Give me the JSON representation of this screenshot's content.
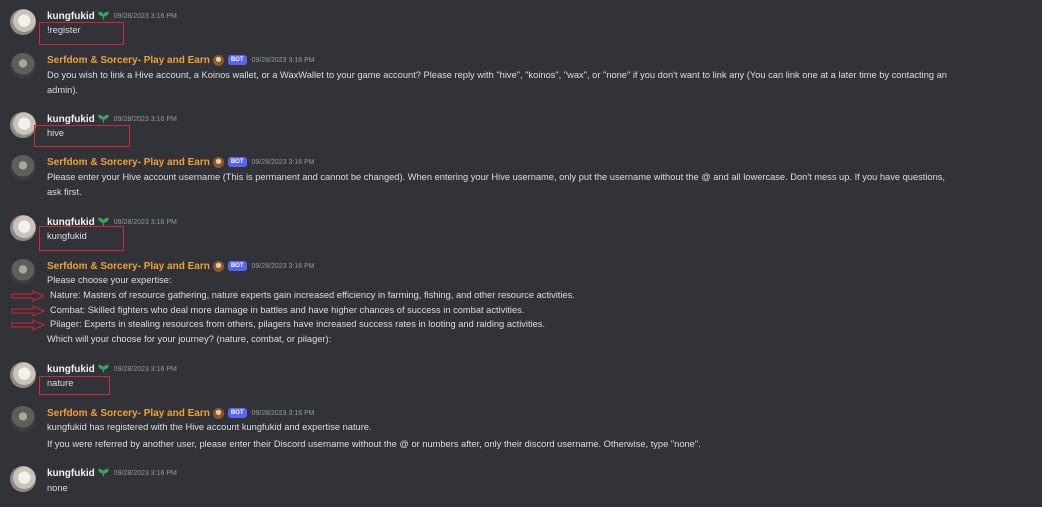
{
  "messages": [
    {
      "author": "kungfukid",
      "timestamp": "09/28/2023 3:16 PM",
      "lines": [
        "!register"
      ]
    },
    {
      "author": "Serfdom & Sorcery- Play and Earn",
      "badge": "BOT",
      "timestamp": "09/28/2023 3:16 PM",
      "lines": [
        "Do you wish to link a Hive account, a Koinos wallet, or a WaxWallet to your game account? Please reply with \"hive\", \"koinos\", \"wax\", or \"none\" if you don't want to link any (You can link one at a later time by contacting an",
        "admin)."
      ]
    },
    {
      "author": "kungfukid",
      "timestamp": "09/28/2023 3:16 PM",
      "lines": [
        "hive"
      ]
    },
    {
      "author": "Serfdom & Sorcery- Play and Earn",
      "badge": "BOT",
      "timestamp": "09/28/2023 3:16 PM",
      "lines": [
        "Please enter your Hive account username (This is permanent and cannot be changed). When entering your Hive username, only put the username without the @ and all lowercase. Don't mess up. If you have questions,",
        "ask first."
      ]
    },
    {
      "author": "kungfukid",
      "timestamp": "09/28/2023 3:16 PM",
      "lines": [
        "kungfukid"
      ]
    },
    {
      "author": "Serfdom & Sorcery- Play and Earn",
      "badge": "BOT",
      "timestamp": "09/28/2023 3:16 PM",
      "lines": [
        "Please choose your expertise:",
        "Nature: Masters of resource gathering, nature experts gain increased efficiency in farming, fishing, and other resource activities.",
        "Combat: Skilled fighters who deal more damage in battles and have higher chances of success in combat activities.",
        "Pilager: Experts in stealing resources from others, pilagers have increased success rates in looting and raiding activities.",
        "Which will your choose for your journey? (nature, combat, or pilager):"
      ]
    },
    {
      "author": "kungfukid",
      "timestamp": "09/28/2023 3:16 PM",
      "lines": [
        "nature"
      ]
    },
    {
      "author": "Serfdom & Sorcery- Play and Earn",
      "badge": "BOT",
      "timestamp": "09/28/2023 3:16 PM",
      "lines": [
        "kungfukid has registered with the Hive account kungfukid and expertise nature.",
        "If you were referred by another user, please enter their Discord username without the @ or numbers after, only their discord username. Otherwise, type \"none\"."
      ]
    },
    {
      "author": "kungfukid",
      "timestamp": "09/28/2023 3:16 PM",
      "lines": [
        "none"
      ]
    }
  ],
  "colors": {
    "background": "#313338",
    "bot_name": "#f0a232",
    "highlight": "#d4272f",
    "bot_badge": "#5865f2"
  }
}
